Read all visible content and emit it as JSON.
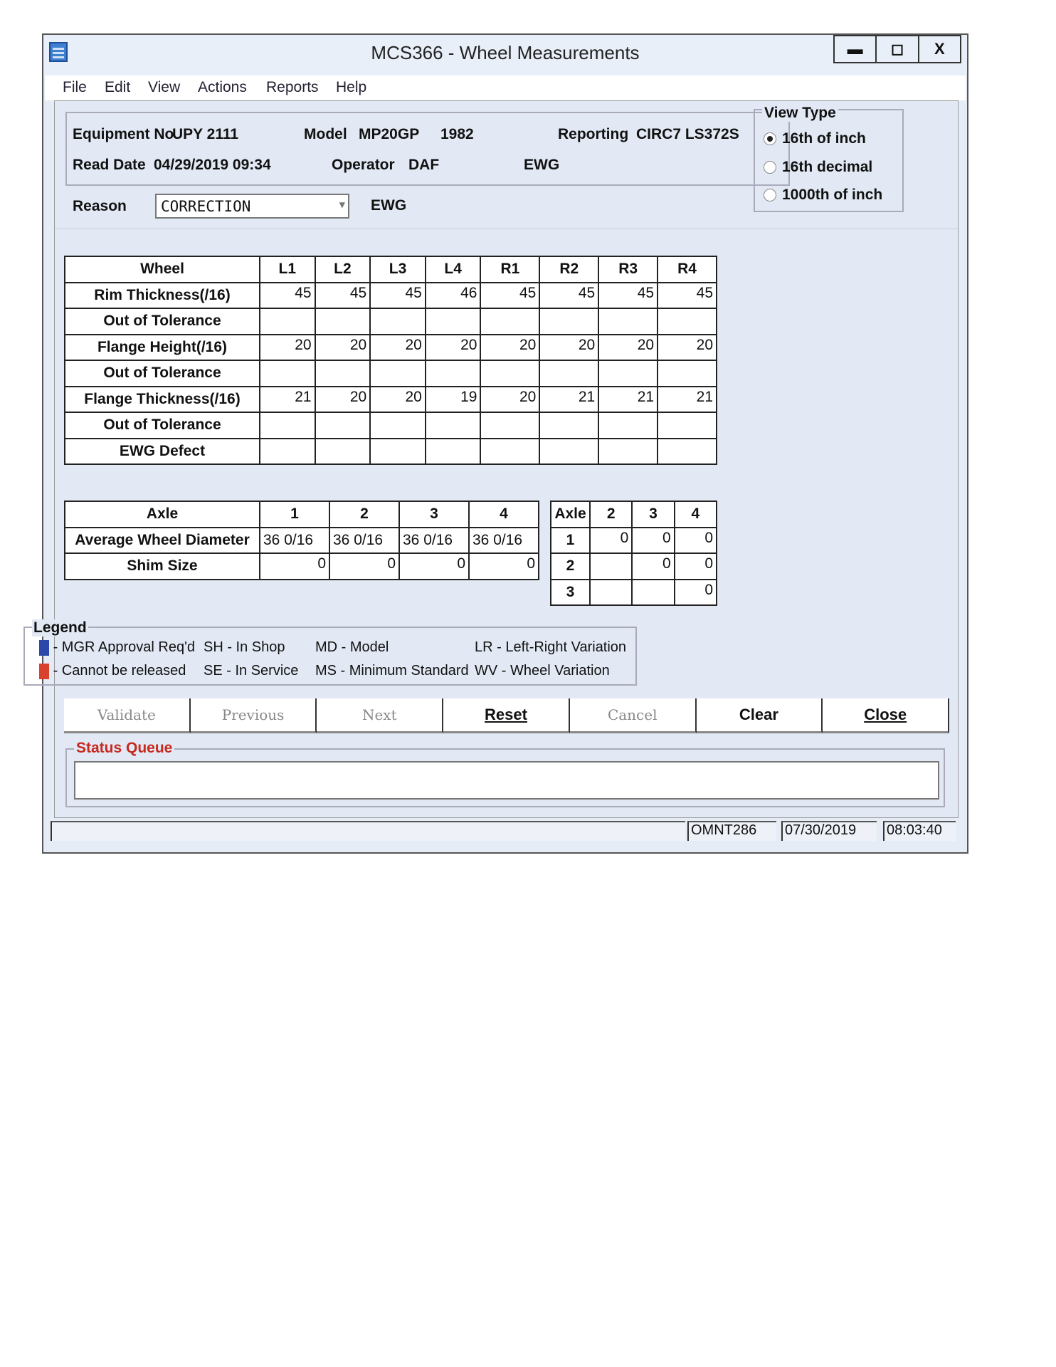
{
  "window": {
    "title": "MCS366 - Wheel Measurements",
    "controls": {
      "minimize": "▬",
      "maximize": "◻",
      "close": "X"
    }
  },
  "menu": [
    "File",
    "Edit",
    "View",
    "Actions",
    "Reports",
    "Help"
  ],
  "info": {
    "equipment_label": "Equipment No",
    "equipment_value": "UPY  2111",
    "model_label": "Model",
    "model_value": "MP20GP",
    "model_year": "1982",
    "reporting_label": "Reporting",
    "reporting_value": "CIRC7  LS372S",
    "read_date_label": "Read Date",
    "read_date_value": "04/29/2019 09:34",
    "operator_label": "Operator",
    "operator_value": "DAF",
    "ewg": "EWG"
  },
  "view_type": {
    "title": "View Type",
    "options": [
      "16th of inch",
      "16th decimal",
      "1000th of inch"
    ],
    "selected": "16th of inch"
  },
  "reason": {
    "label": "Reason",
    "value": "CORRECTION",
    "ewg": "EWG"
  },
  "wheel_table": {
    "headers": [
      "Wheel",
      "L1",
      "L2",
      "L3",
      "L4",
      "R1",
      "R2",
      "R3",
      "R4"
    ],
    "rows": [
      {
        "label": "Rim Thickness(/16)",
        "values": [
          "45",
          "45",
          "45",
          "46",
          "45",
          "45",
          "45",
          "45"
        ]
      },
      {
        "label": "Out of Tolerance",
        "values": [
          "",
          "",
          "",
          "",
          "",
          "",
          "",
          ""
        ]
      },
      {
        "label": "Flange Height(/16)",
        "values": [
          "20",
          "20",
          "20",
          "20",
          "20",
          "20",
          "20",
          "20"
        ]
      },
      {
        "label": "Out of Tolerance",
        "values": [
          "",
          "",
          "",
          "",
          "",
          "",
          "",
          ""
        ]
      },
      {
        "label": "Flange Thickness(/16)",
        "values": [
          "21",
          "20",
          "20",
          "19",
          "20",
          "21",
          "21",
          "21"
        ]
      },
      {
        "label": "Out of Tolerance",
        "values": [
          "",
          "",
          "",
          "",
          "",
          "",
          "",
          ""
        ]
      },
      {
        "label": "EWG Defect",
        "values": [
          "",
          "",
          "",
          "",
          "",
          "",
          "",
          ""
        ]
      }
    ]
  },
  "axle_table": {
    "headers": [
      "Axle",
      "1",
      "2",
      "3",
      "4"
    ],
    "rows": [
      {
        "label": "Average Wheel Diameter",
        "values": [
          "36  0/16",
          "36  0/16",
          "36  0/16",
          "36  0/16"
        ]
      },
      {
        "label": "Shim Size",
        "values": [
          "0",
          "0",
          "0",
          "0"
        ]
      }
    ]
  },
  "axle_matrix": {
    "headers": [
      "Axle",
      "2",
      "3",
      "4"
    ],
    "rows": [
      {
        "label": "1",
        "values": [
          "0",
          "0",
          "0"
        ]
      },
      {
        "label": "2",
        "values": [
          "",
          "0",
          "0"
        ]
      },
      {
        "label": "3",
        "values": [
          "",
          "",
          "0"
        ]
      }
    ]
  },
  "legend": {
    "title": "Legend",
    "blue_color": "#2b48a8",
    "red_color": "#d9412c",
    "items": [
      "- MGR Approval Req'd",
      "- Cannot be released",
      "SH - In Shop",
      "SE - In Service",
      "MD - Model",
      "MS - Minimum Standard",
      "LR - Left-Right Variation",
      "WV - Wheel Variation"
    ]
  },
  "buttons": [
    {
      "label": "Validate",
      "enabled": false
    },
    {
      "label": "Previous",
      "enabled": false
    },
    {
      "label": "Next",
      "enabled": false
    },
    {
      "label": "Reset",
      "enabled": true
    },
    {
      "label": "Cancel",
      "enabled": false
    },
    {
      "label": "Clear",
      "enabled": true
    },
    {
      "label": "Close",
      "enabled": true
    }
  ],
  "status_queue": {
    "title": "Status Queue",
    "value": ""
  },
  "status_bar": {
    "message": "",
    "user": "OMNT286",
    "date": "07/30/2019",
    "time": "08:03:40"
  }
}
